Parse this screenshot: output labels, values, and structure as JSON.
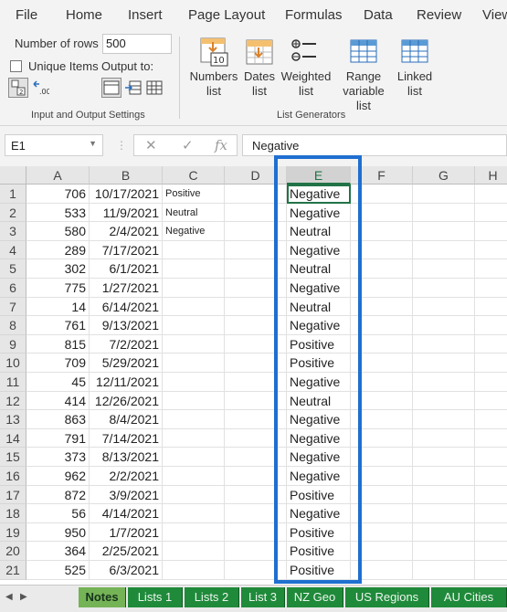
{
  "menu": [
    "File",
    "Home",
    "Insert",
    "Page Layout",
    "Formulas",
    "Data",
    "Review",
    "View"
  ],
  "ribbon": {
    "number_of_rows_label": "Number of rows",
    "number_of_rows_value": "500",
    "unique_items_label": "Unique Items",
    "output_to_label": "Output to:",
    "group1_label": "Input and Output Settings",
    "group2_label": "List Generators",
    "buttons": {
      "numbers": "Numbers list",
      "dates": "Dates list",
      "weighted": "Weighted list",
      "range": "Range variable list",
      "linked": "Linked list"
    },
    "icons": [
      "sort-ascending-icon",
      "swap-arrows-icon",
      "output-sheet-icon",
      "output-arrow-icon",
      "output-columns-icon",
      "numbers-list-icon",
      "dates-list-icon",
      "weighted-list-icon",
      "range-list-icon",
      "linked-list-icon"
    ]
  },
  "formula_bar": {
    "name_box": "E1",
    "cancel": "✕",
    "enter": "✓",
    "fx": "fx",
    "content": "Negative"
  },
  "columns": [
    "A",
    "B",
    "C",
    "D",
    "E",
    "F",
    "G",
    "H"
  ],
  "rows": [
    {
      "n": "1",
      "a": "706",
      "b": "10/17/2021",
      "c": "Positive",
      "e": "Negative"
    },
    {
      "n": "2",
      "a": "533",
      "b": "11/9/2021",
      "c": "Neutral",
      "e": "Negative"
    },
    {
      "n": "3",
      "a": "580",
      "b": "2/4/2021",
      "c": "Negative",
      "e": "Neutral"
    },
    {
      "n": "4",
      "a": "289",
      "b": "7/17/2021",
      "c": "",
      "e": "Negative"
    },
    {
      "n": "5",
      "a": "302",
      "b": "6/1/2021",
      "c": "",
      "e": "Neutral"
    },
    {
      "n": "6",
      "a": "775",
      "b": "1/27/2021",
      "c": "",
      "e": "Negative"
    },
    {
      "n": "7",
      "a": "14",
      "b": "6/14/2021",
      "c": "",
      "e": "Neutral"
    },
    {
      "n": "8",
      "a": "761",
      "b": "9/13/2021",
      "c": "",
      "e": "Negative"
    },
    {
      "n": "9",
      "a": "815",
      "b": "7/2/2021",
      "c": "",
      "e": "Positive"
    },
    {
      "n": "10",
      "a": "709",
      "b": "5/29/2021",
      "c": "",
      "e": "Positive"
    },
    {
      "n": "11",
      "a": "45",
      "b": "12/11/2021",
      "c": "",
      "e": "Negative"
    },
    {
      "n": "12",
      "a": "414",
      "b": "12/26/2021",
      "c": "",
      "e": "Neutral"
    },
    {
      "n": "13",
      "a": "863",
      "b": "8/4/2021",
      "c": "",
      "e": "Negative"
    },
    {
      "n": "14",
      "a": "791",
      "b": "7/14/2021",
      "c": "",
      "e": "Negative"
    },
    {
      "n": "15",
      "a": "373",
      "b": "8/13/2021",
      "c": "",
      "e": "Negative"
    },
    {
      "n": "16",
      "a": "962",
      "b": "2/2/2021",
      "c": "",
      "e": "Negative"
    },
    {
      "n": "17",
      "a": "872",
      "b": "3/9/2021",
      "c": "",
      "e": "Positive"
    },
    {
      "n": "18",
      "a": "56",
      "b": "4/14/2021",
      "c": "",
      "e": "Negative"
    },
    {
      "n": "19",
      "a": "950",
      "b": "1/7/2021",
      "c": "",
      "e": "Positive"
    },
    {
      "n": "20",
      "a": "364",
      "b": "2/25/2021",
      "c": "",
      "e": "Positive"
    },
    {
      "n": "21",
      "a": "525",
      "b": "6/3/2021",
      "c": "",
      "e": "Positive"
    }
  ],
  "sheet_tabs": [
    "Notes",
    "Lists 1",
    "Lists 2",
    "List 3",
    "NZ Geo",
    "US Regions",
    "AU Cities"
  ],
  "active_tab": "Notes",
  "colors": {
    "accent": "#217346",
    "highlight_box": "#1e6fd0",
    "tab_green": "#1f8a3a"
  }
}
